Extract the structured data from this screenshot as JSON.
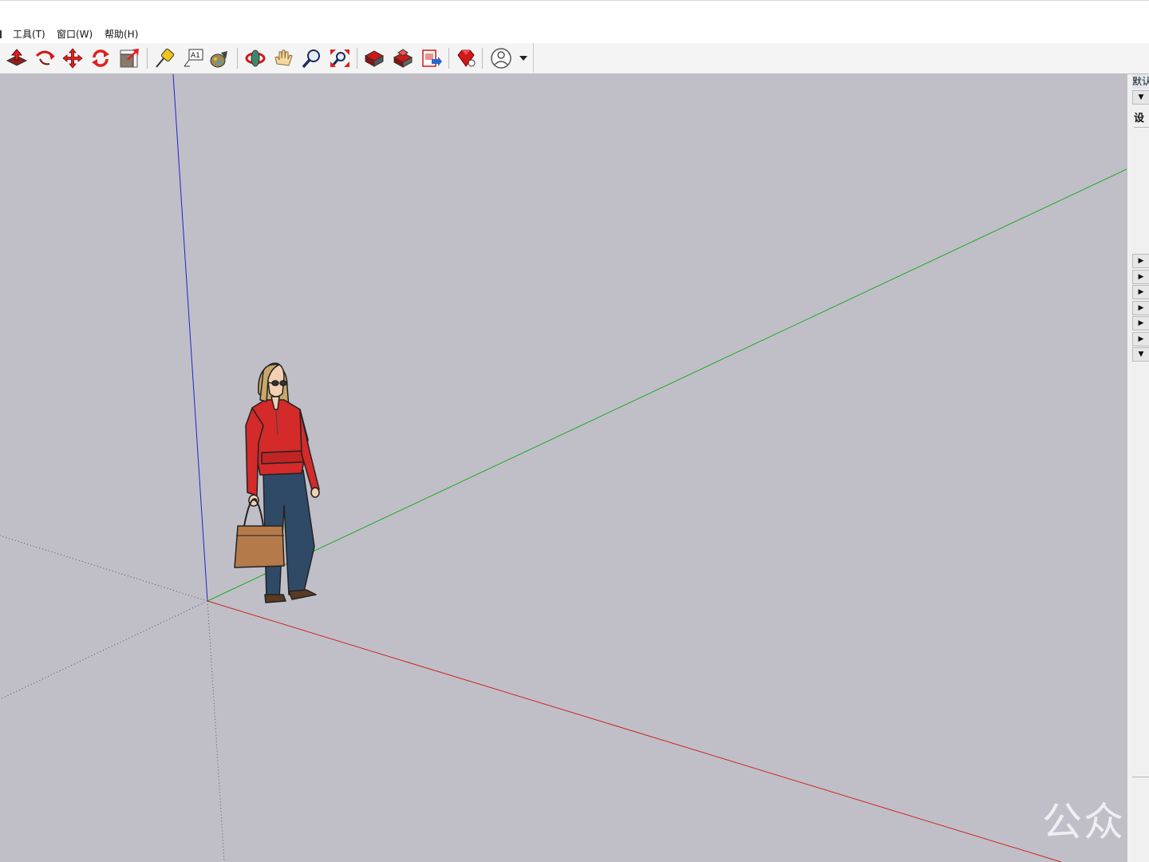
{
  "menu": {
    "items": [
      {
        "label": "工具(T)"
      },
      {
        "label": "窗口(W)"
      },
      {
        "label": "帮助(H)"
      }
    ]
  },
  "toolbar": {
    "buttons": [
      {
        "icon": "push-pull-icon"
      },
      {
        "icon": "follow-me-icon"
      },
      {
        "icon": "move-icon"
      },
      {
        "icon": "rotate-icon"
      },
      {
        "icon": "scale-icon"
      },
      {
        "icon": "tape-measure-icon"
      },
      {
        "icon": "text-label-icon",
        "text": "A1"
      },
      {
        "icon": "paint-bucket-icon"
      },
      {
        "icon": "orbit-icon"
      },
      {
        "icon": "pan-icon"
      },
      {
        "icon": "zoom-icon"
      },
      {
        "icon": "zoom-extents-icon"
      },
      {
        "icon": "3d-warehouse-icon"
      },
      {
        "icon": "extension-warehouse-icon"
      },
      {
        "icon": "layout-send-icon"
      },
      {
        "icon": "ruby-extension-icon"
      },
      {
        "icon": "account-icon"
      }
    ]
  },
  "right_panel": {
    "title": "默认",
    "setting_label": "设"
  },
  "watermark": "公众号",
  "colors": {
    "viewport_bg": "#c0bfc8",
    "axis_red": "#cc2222",
    "axis_green": "#22aa22",
    "axis_blue": "#2222cc"
  }
}
